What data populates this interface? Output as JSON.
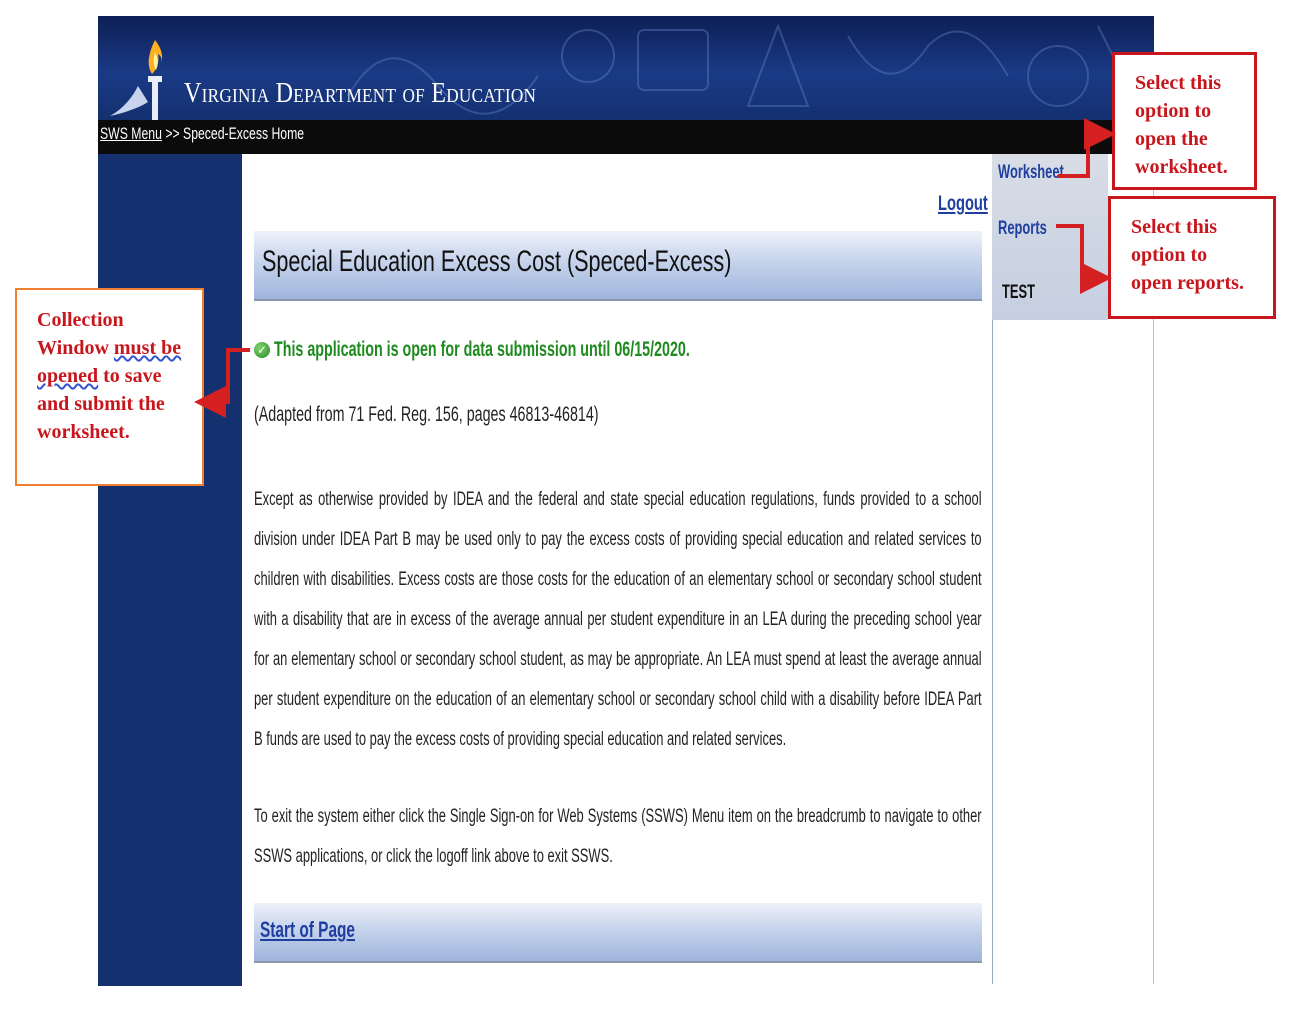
{
  "header": {
    "title": "Virginia Department of Education",
    "breadcrumb": {
      "link": "SWS Menu",
      "separator": ">>",
      "current": "Speced-Excess Home"
    }
  },
  "sidebar": {
    "items": [
      {
        "label": "Worksheet"
      },
      {
        "label": "Reports"
      },
      {
        "label": "TEST"
      }
    ]
  },
  "main": {
    "logout_label": "Logout",
    "title": "Special Education Excess Cost (Speced-Excess)",
    "status_text": "This application is open for data submission until 06/15/2020.",
    "adapted": "(Adapted from 71 Fed. Reg. 156, pages 46813-46814)",
    "paragraph1": "Except as otherwise provided by IDEA and the federal and state special education regulations, funds provided to a school division under IDEA Part B may be used only to pay the excess costs of providing special education and related services to children with disabilities. Excess costs are those costs for the education of an elementary school or secondary school student with a disability that are in excess of the average annual per student expenditure in an LEA during the preceding school year for an elementary school or secondary school student, as may be appropriate. An LEA must spend at least the average annual per student expenditure on the education of an elementary school or secondary school child with a disability before IDEA Part B funds are used to pay the excess costs of providing special education and related services.",
    "paragraph2": "To exit the system either click the Single Sign-on for Web Systems (SSWS) Menu item on the breadcrumb to navigate to other SSWS applications, or click the logoff link above to exit SSWS.",
    "start_of_page": "Start of Page"
  },
  "annotations": {
    "collection": {
      "line1": "Collection",
      "line2a": "Window ",
      "line2b": "must be",
      "line3a": "opened",
      "line3b": " to save",
      "line4": "and submit the",
      "line5": "worksheet."
    },
    "worksheet": {
      "line1": "Select this",
      "line2": "option to",
      "line3": "open the",
      "line4": "worksheet."
    },
    "reports": {
      "line1": "Select this",
      "line2": "option to",
      "line3": "open reports."
    }
  },
  "colors": {
    "navy": "#15306e",
    "link_blue": "#1e3fa0",
    "status_green": "#1f8a1f",
    "annotation_red": "#c8161d",
    "annotation_orange": "#f08030"
  }
}
